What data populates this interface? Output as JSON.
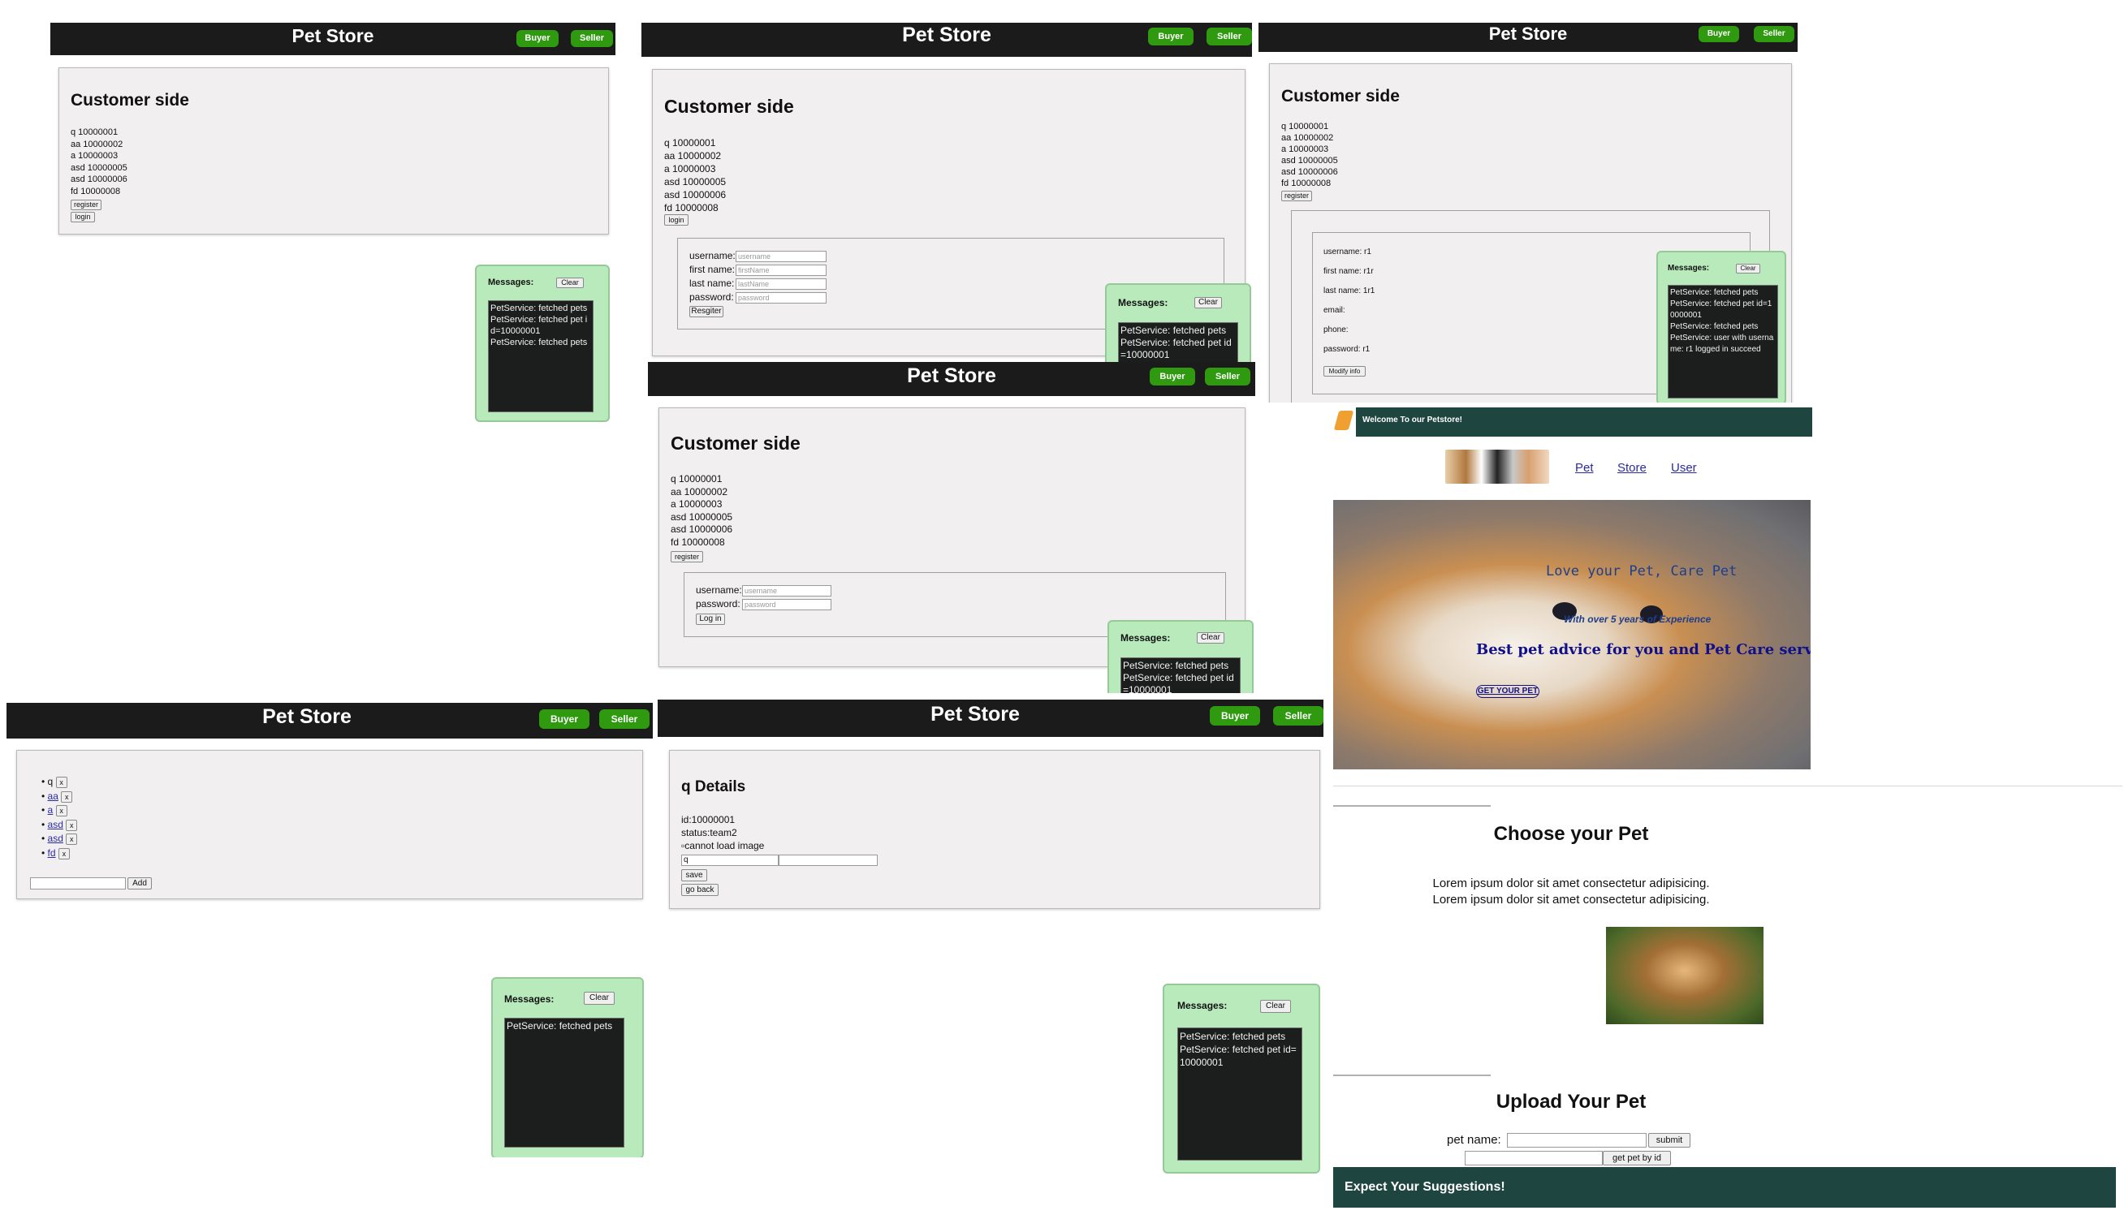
{
  "app": {
    "title": "Pet Store",
    "buyer": "Buyer",
    "seller": "Seller"
  },
  "customer": {
    "heading": "Customer side",
    "register": "register",
    "login": "login",
    "users": [
      "q 10000001",
      "aa 10000002",
      "a 10000003",
      "asd 10000005",
      "asd 10000006",
      "fd 10000008"
    ]
  },
  "messages": {
    "title": "Messages:",
    "clear": "Clear",
    "m1": [
      "PetService: fetched pets",
      "PetService: fetched pet id=10000001",
      "PetService: fetched pets"
    ],
    "m2": [
      "PetService: fetched pets",
      "PetService: fetched pet id=10000001"
    ],
    "m3": [
      "PetService: fetched pets",
      "PetService: fetched pet id=10000001",
      "PetService: fetched pets",
      "PetService: user with username: r1 logged in succeed"
    ],
    "m4": [
      "PetService: fetched pets",
      "PetService: fetched pet id=10000001"
    ],
    "m5": [
      "PetService: fetched pets"
    ],
    "m6": [
      "PetService: fetched pets",
      "PetService: fetched pet id=10000001"
    ]
  },
  "register_form": {
    "labels": [
      "username:",
      "first name:",
      "last name:",
      "password:"
    ],
    "placeholders": [
      "username",
      "firstName",
      "lastName",
      "password"
    ],
    "button": "Resgiter"
  },
  "login_form": {
    "labels": [
      "username:",
      "password:"
    ],
    "placeholders": [
      "username",
      "password"
    ],
    "button": "Log in"
  },
  "profile": {
    "rows": [
      "username: r1",
      "first name: r1r",
      "last name: 1r1",
      "email:",
      "phone:",
      "password: r1"
    ],
    "button": "Modify info"
  },
  "petlist": {
    "items": [
      "q",
      "aa",
      "a",
      "asd",
      "asd",
      "fd"
    ],
    "remove": "x",
    "add": "Add"
  },
  "detail": {
    "heading": "q Details",
    "id": "id:10000001",
    "status": "status:team2",
    "img_alt": "cannot load image",
    "name_value": "q",
    "save": "save",
    "back": "go back"
  },
  "landing": {
    "welcome": "Welcome To our Petstore!",
    "nav": [
      "Pet",
      "Store",
      "User"
    ],
    "hero_line1": "Love your Pet, Care Pet",
    "hero_line2": "With over 5 years of Experience",
    "hero_line3": "Best pet advice for you and Pet Care services",
    "hero_btn": "GET YOUR PET",
    "choose_title": "Choose your Pet",
    "lorem": [
      "Lorem ipsum dolor sit amet consectetur adipisicing.",
      "Lorem ipsum dolor sit amet consectetur adipisicing."
    ],
    "upload_title": "Upload Your Pet",
    "pet_name_label": "pet name:",
    "submit": "submit",
    "get_by_id": "get pet by id",
    "footer": "Expect Your Suggestions!"
  },
  "colors": {
    "topbar": "#1b1b1b",
    "nav_button": "#2f9a10",
    "messages_bg": "#b8eabb",
    "landing_header": "#1f4540"
  }
}
